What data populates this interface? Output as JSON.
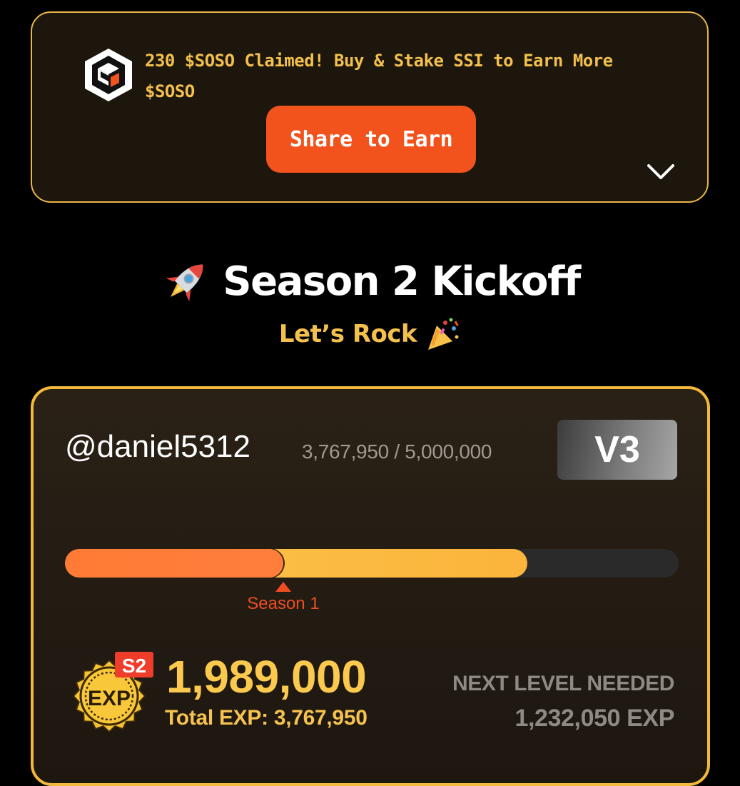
{
  "banner": {
    "message": "230 $SOSO Claimed! Buy & Stake SSI to Earn More $SOSO",
    "share_label": "Share to Earn",
    "logo_icon": "sosovalue-cube-logo",
    "toggle_icon": "chevron-down-icon"
  },
  "season": {
    "title": "Season 2 Kickoff",
    "subtitle": "Let’s Rock",
    "title_icon": "rocket-icon",
    "subtitle_icon": "party-popper-icon"
  },
  "profile": {
    "username": "@daniel5312",
    "progress_text": "3,767,950 / 5,000,000",
    "level": "V3",
    "bar": {
      "current_exp": 3767950,
      "target_exp": 5000000,
      "season1_exp": 1778950,
      "marker_label": "Season 1"
    },
    "medal": {
      "season_tag": "S2",
      "label": "EXP"
    },
    "season_exp": "1,989,000",
    "total_exp": "Total EXP: 3,767,950",
    "next_level_label": "NEXT LEVEL NEEDED",
    "next_level_value": "1,232,050 EXP"
  },
  "colors": {
    "accent_gold": "#f3c04d",
    "accent_orange": "#f2521c",
    "card_border": "#f2b93a",
    "bar_season1": "#ff7b35",
    "bar_season2": "#fbc54b",
    "marker": "#ee4d22"
  }
}
